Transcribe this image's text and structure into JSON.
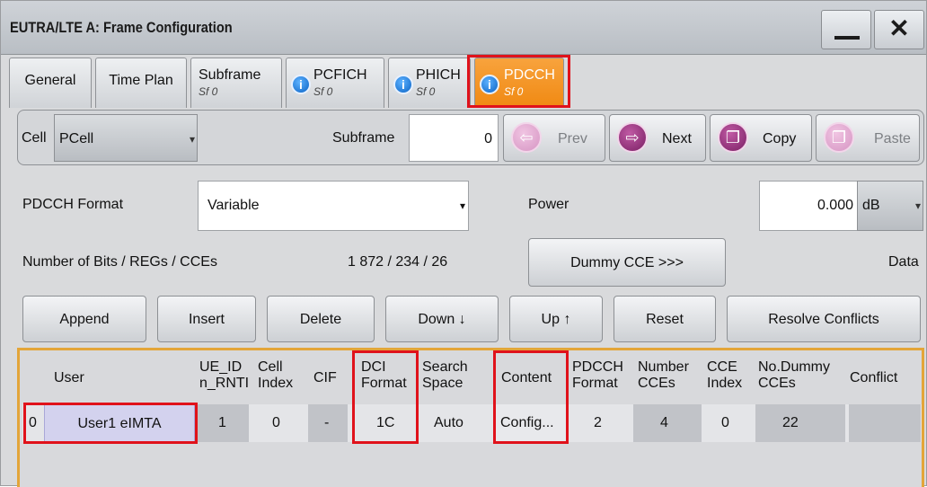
{
  "window": {
    "title": "EUTRA/LTE A: Frame Configuration",
    "minimize_icon": "minimize-icon",
    "close_icon": "close-icon",
    "close_glyph": "✕"
  },
  "tabs": [
    {
      "name": "General",
      "sub": ""
    },
    {
      "name": "Time Plan",
      "sub": ""
    },
    {
      "name": "Subframe",
      "sub": "Sf 0"
    },
    {
      "name": "PCFICH",
      "sub": "Sf 0"
    },
    {
      "name": "PHICH",
      "sub": "Sf 0"
    },
    {
      "name": "PDCCH",
      "sub": "Sf 0"
    }
  ],
  "cell_panel": {
    "cell_label": "Cell",
    "cell_value": "PCell",
    "subframe_label": "Subframe",
    "subframe_value": "0",
    "prev_label": "Prev",
    "next_label": "Next",
    "copy_label": "Copy",
    "paste_label": "Paste"
  },
  "format": {
    "pdcch_format_label": "PDCCH Format",
    "pdcch_format_value": "Variable",
    "power_label": "Power",
    "power_value": "0.000",
    "power_unit": "dB",
    "bits_label": "Number of Bits / REGs / CCEs",
    "bits_value": "1 872 / 234 / 26",
    "dummy_cce_label": "Dummy CCE >>>",
    "data_label": "Data"
  },
  "actions": {
    "append": "Append",
    "insert": "Insert",
    "delete": "Delete",
    "down": "Down ↓",
    "up": "Up ↑",
    "reset": "Reset",
    "resolve": "Resolve Conflicts"
  },
  "table": {
    "headers": {
      "user": "User",
      "ue_id_1": "UE_ID",
      "ue_id_2": "n_RNTI",
      "cell_index_1": "Cell",
      "cell_index_2": "Index",
      "cif": "CIF",
      "dci_1": "DCI",
      "dci_2": "Format",
      "search_1": "Search",
      "search_2": "Space",
      "content": "Content",
      "pdcch_format_1": "PDCCH",
      "pdcch_format_2": "Format",
      "num_cces_1": "Number",
      "num_cces_2": "CCEs",
      "cce_index_1": "CCE",
      "cce_index_2": "Index",
      "dummy_1": "No.Dummy",
      "dummy_2": "CCEs",
      "conflict": "Conflict"
    },
    "rows": [
      {
        "index": "0",
        "user": "User1 eIMTA",
        "ue_id": "1",
        "cell_index": "0",
        "cif": "-",
        "dci_format": "1C",
        "search_space": "Auto",
        "content": "Config...",
        "pdcch_format": "2",
        "num_cces": "4",
        "cce_index": "0",
        "dummy_cces": "22",
        "conflict": ""
      }
    ]
  },
  "colors": {
    "active_tab": "#f08912",
    "highlight": "#e0121b",
    "table_frame": "#e3a539"
  }
}
